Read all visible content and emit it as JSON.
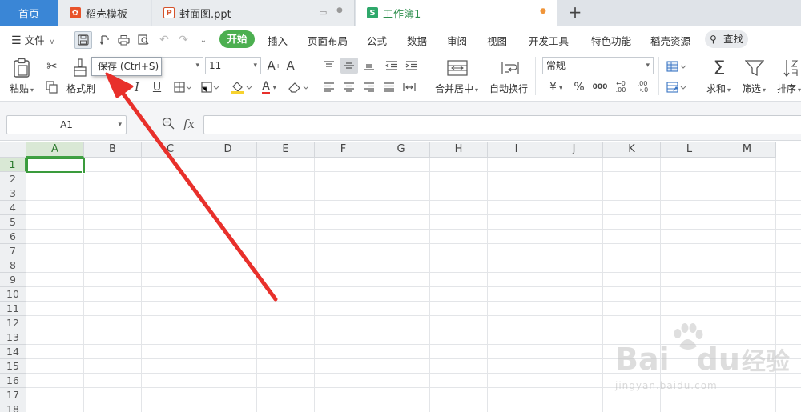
{
  "tabs": {
    "home": "首页",
    "templates": "稻壳模板",
    "ppt": "封面图.ppt",
    "workbook": "工作簿1"
  },
  "menu": {
    "file": "文件",
    "start": "开始",
    "insert": "插入",
    "page_layout": "页面布局",
    "formulas": "公式",
    "data": "数据",
    "review": "审阅",
    "view": "视图",
    "developer": "开发工具",
    "features": "特色功能",
    "docer": "稻壳资源",
    "search": "查找"
  },
  "tooltip": "保存 (Ctrl+S)",
  "ribbon": {
    "paste": "粘贴",
    "format_painter": "格式刷",
    "font_size": "11",
    "merge_center": "合并居中",
    "wrap_text": "自动换行",
    "number_format": "常规",
    "sum": "求和",
    "filter": "筛选",
    "sort": "排序",
    "bold": "B",
    "italic": "I",
    "underline": "U",
    "font_grow": "A",
    "font_shrink": "A",
    "font_color": "A",
    "currency": "¥",
    "percent": "%",
    "thousands": "000"
  },
  "name_box": "A1",
  "fx": "fx",
  "columns": [
    "A",
    "B",
    "C",
    "D",
    "E",
    "F",
    "G",
    "H",
    "I",
    "J",
    "K",
    "L",
    "M"
  ],
  "rows": [
    "1",
    "2",
    "3",
    "4",
    "5",
    "6",
    "7",
    "8",
    "9",
    "10",
    "11",
    "12",
    "13",
    "14",
    "15",
    "16",
    "17",
    "18"
  ],
  "watermark": {
    "brand": "Bai",
    "brand2": "du",
    "brand3": "经验",
    "url": "jingyan.baidu.com"
  },
  "colors": {
    "accent_green": "#4caf50",
    "home_blue": "#3a86d6",
    "arrow_red": "#e8302b"
  }
}
